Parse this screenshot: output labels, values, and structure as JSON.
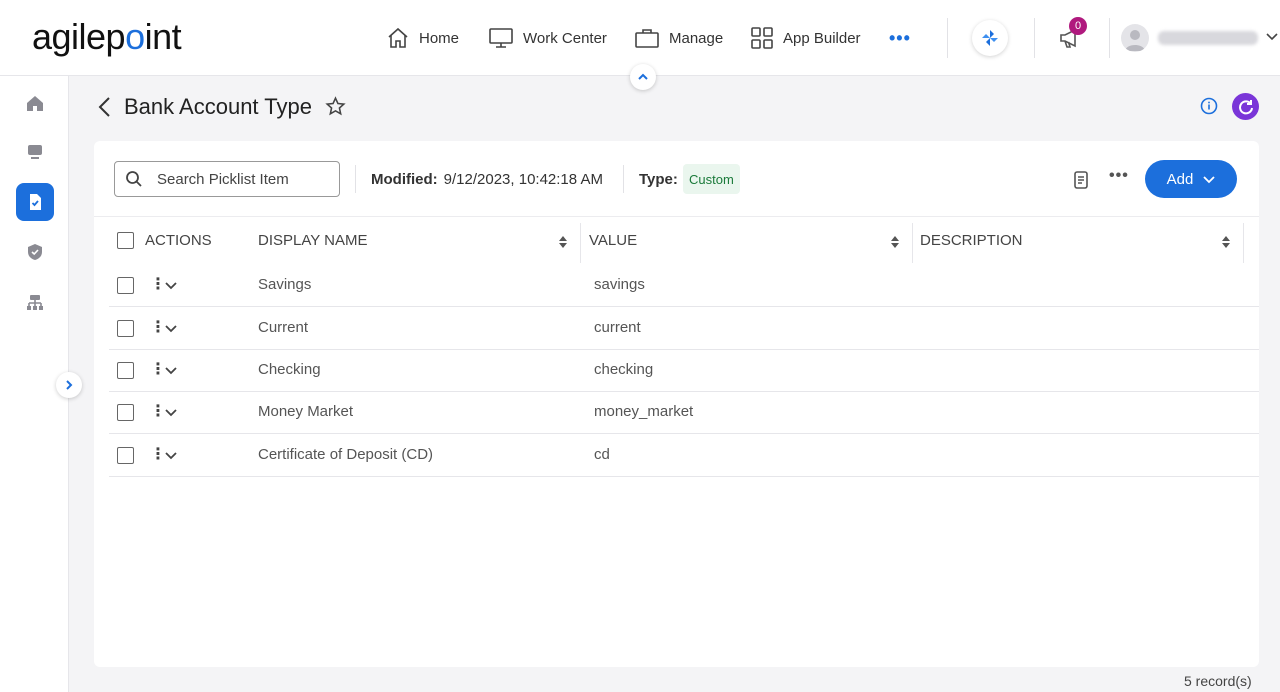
{
  "brand": {
    "logo_text_a": "agilep",
    "logo_text_b": "int"
  },
  "topnav": {
    "items": [
      {
        "label": "Home",
        "icon": "home-icon"
      },
      {
        "label": "Work Center",
        "icon": "monitor-icon"
      },
      {
        "label": "Manage",
        "icon": "briefcase-icon"
      },
      {
        "label": "App Builder",
        "icon": "grid-icon"
      }
    ],
    "more": "•••",
    "notification_count": "0"
  },
  "page": {
    "title": "Bank Account Type"
  },
  "toolbar": {
    "search_placeholder": "Search Picklist Item",
    "modified_label": "Modified:",
    "modified_value": "9/12/2023, 10:42:18 AM",
    "type_label": "Type:",
    "type_value": "Custom",
    "more": "•••",
    "add_label": "Add"
  },
  "table": {
    "columns": [
      "ACTIONS",
      "DISPLAY NAME",
      "VALUE",
      "DESCRIPTION"
    ],
    "rows": [
      {
        "display_name": "Savings",
        "value": "savings",
        "description": ""
      },
      {
        "display_name": "Current",
        "value": "current",
        "description": ""
      },
      {
        "display_name": "Checking",
        "value": "checking",
        "description": ""
      },
      {
        "display_name": "Money Market",
        "value": "money_market",
        "description": ""
      },
      {
        "display_name": "Certificate of Deposit (CD)",
        "value": "cd",
        "description": ""
      }
    ],
    "kebab": "⋮"
  },
  "footer": {
    "records": "5 record(s)"
  },
  "colors": {
    "accent": "#1c6fdc",
    "badge": "#b0197e",
    "refresh": "#7a35d8",
    "chip_bg": "#eaf6ee",
    "chip_text": "#1a7a3a"
  }
}
